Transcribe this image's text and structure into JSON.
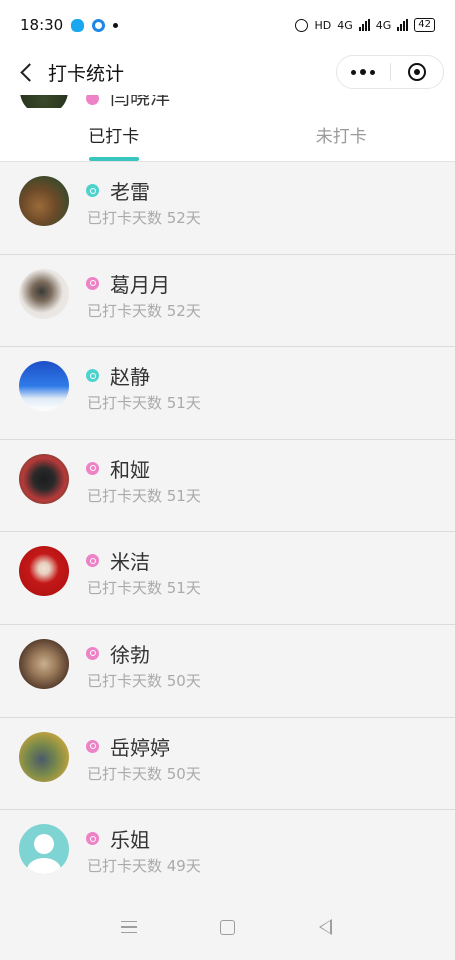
{
  "status_bar": {
    "time": "18:30",
    "hd_label": "HD",
    "network_1": "4G",
    "network_2": "4G",
    "battery": "42"
  },
  "nav": {
    "title": "打卡统计"
  },
  "peek_row": {
    "name": "闫晓洋"
  },
  "tabs": [
    {
      "label": "已打卡",
      "active": true
    },
    {
      "label": "未打卡",
      "active": false
    }
  ],
  "members": [
    {
      "name": "老雷",
      "days": "已打卡天数 52天",
      "gender": "male"
    },
    {
      "name": "葛月月",
      "days": "已打卡天数 52天",
      "gender": "female"
    },
    {
      "name": "赵静",
      "days": "已打卡天数 51天",
      "gender": "male"
    },
    {
      "name": "和娅",
      "days": "已打卡天数 51天",
      "gender": "female"
    },
    {
      "name": "米洁",
      "days": "已打卡天数 51天",
      "gender": "female"
    },
    {
      "name": "徐勃",
      "days": "已打卡天数 50天",
      "gender": "female"
    },
    {
      "name": "岳婷婷",
      "days": "已打卡天数 50天",
      "gender": "female"
    },
    {
      "name": "乐姐",
      "days": "已打卡天数 49天",
      "gender": "female"
    }
  ],
  "colors": {
    "accent": "#39c5c0",
    "female_badge": "#ee82c6",
    "male_badge": "#4dd2cd"
  },
  "icons": {
    "back": "chevron-left-icon",
    "more": "more-dots-icon",
    "close": "target-circle-icon"
  }
}
